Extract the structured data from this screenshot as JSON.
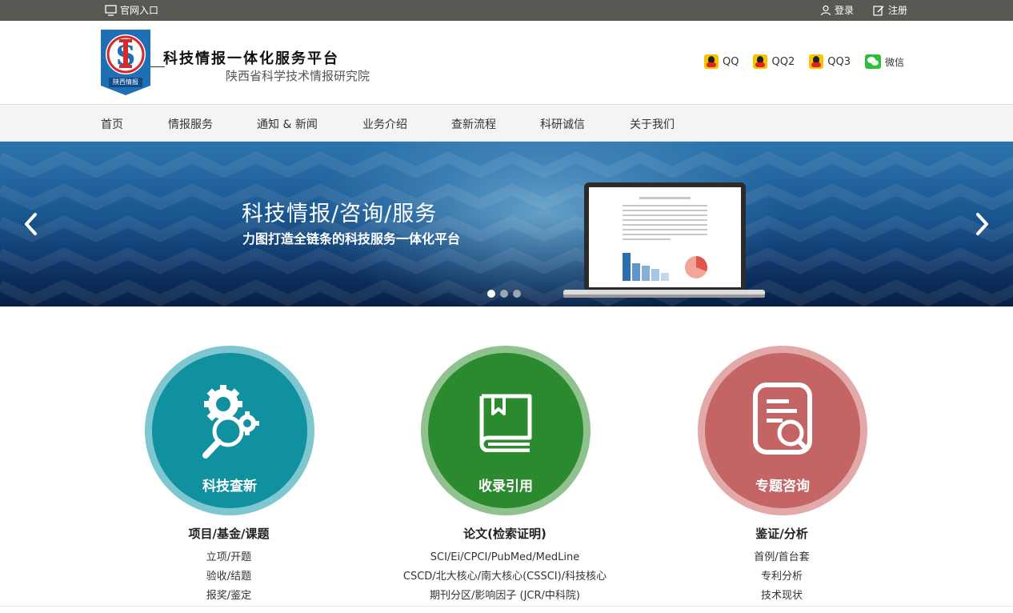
{
  "topbar": {
    "portal": "官网入口",
    "login": "登录",
    "register": "注册"
  },
  "header": {
    "logo_text": "陕西情报",
    "title": "科技情报一体化服务平台",
    "subtitle": "陕西省科学技术情报研究院",
    "contacts": [
      {
        "label": "QQ",
        "icon": "qq-icon"
      },
      {
        "label": "QQ2",
        "icon": "qq-icon"
      },
      {
        "label": "QQ3",
        "icon": "qq-icon"
      },
      {
        "label": "微信",
        "icon": "wechat-icon"
      }
    ]
  },
  "nav": {
    "items": [
      "首页",
      "情报服务",
      "通知 & 新闻",
      "业务介绍",
      "查新流程",
      "科研诚信",
      "关于我们"
    ]
  },
  "banner": {
    "title": "科技情报/咨询/服务",
    "subtitle": "力图打造全链条的科技服务一体化平台",
    "slides": 3,
    "active_slide": 1
  },
  "services": [
    {
      "label": "科技查新",
      "heading": "项目/基金/课题",
      "items": [
        "立项/开题",
        "验收/结题",
        "报奖/鉴定"
      ],
      "color": "#11909f",
      "ring": "#7ec7d0"
    },
    {
      "label": "收录引用",
      "heading": "论文(检索证明)",
      "items": [
        "SCI/Ei/CPCI/PubMed/MedLine",
        "CSCD/北大核心/南大核心(CSSCI)/科技核心",
        "期刊分区/影响因子 (JCR/中科院)"
      ],
      "color": "#2a8a2d",
      "ring": "#8fc28f"
    },
    {
      "label": "专题咨询",
      "heading": "鉴证/分析",
      "items": [
        "首例/首台套",
        "专利分析",
        "技术现状"
      ],
      "color": "#c46464",
      "ring": "#e3a9a9"
    }
  ]
}
